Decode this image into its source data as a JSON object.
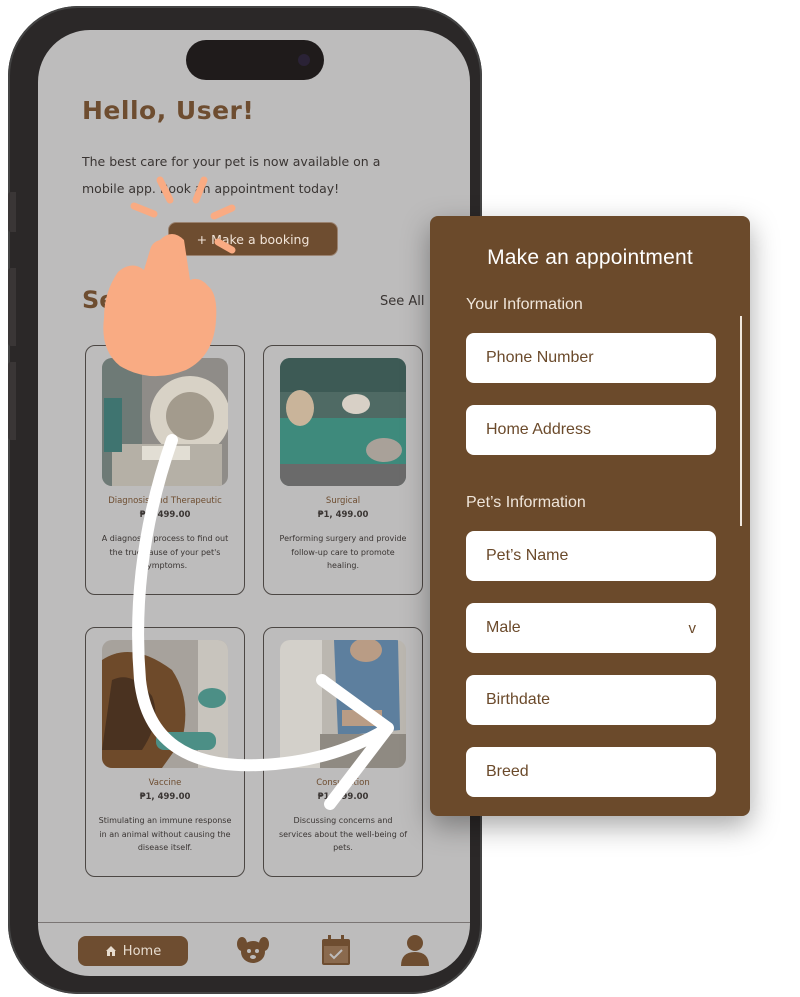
{
  "app": {
    "greeting": "Hello, User!",
    "intro": "The best care for your pet is now available on a mobile app. Book an appointment today!",
    "booking_button": "Make a booking",
    "booking_plus": "+",
    "services_title": "Services",
    "see_all": "See All"
  },
  "services": [
    {
      "title": "Diagnosis and Therapeutic",
      "price": "₱1, 499.00",
      "desc": "A diagnostic process to find out the true cause of your pet's symptoms."
    },
    {
      "title": "Surgical",
      "price": "₱1, 499.00",
      "desc": "Performing surgery and provide follow-up care to promote healing."
    },
    {
      "title": "Vaccine",
      "price": "₱1, 499.00",
      "desc": "Stimulating an immune response in an animal without causing the disease itself."
    },
    {
      "title": "Consultation",
      "price": "₱1, 499.00",
      "desc": "Discussing concerns and services about the well-being of pets."
    }
  ],
  "nav": {
    "home": "Home",
    "icons": [
      "home-icon",
      "pets-icon",
      "calendar-icon",
      "profile-icon"
    ]
  },
  "appointment": {
    "title": "Make an appointment",
    "your_info_label": "Your Information",
    "phone_placeholder": "Phone Number",
    "address_placeholder": "Home Address",
    "pet_info_label": "Pet’s Information",
    "pet_name_placeholder": "Pet’s Name",
    "sex_value": "Male",
    "sex_chevron": "v",
    "birthdate_placeholder": "Birthdate",
    "breed_placeholder": "Breed"
  },
  "colors": {
    "brand_brown": "#6b4a2b",
    "screen_gray": "#bdbcbc",
    "hand": "#f9ab83",
    "white": "#ffffff"
  }
}
